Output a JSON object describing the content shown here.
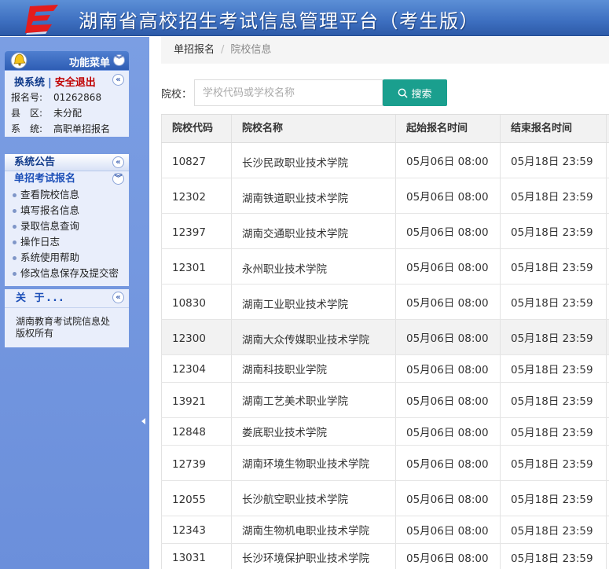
{
  "header": {
    "title": "湖南省高校招生考试信息管理平台（考生版）"
  },
  "sidebar": {
    "menu_title": "功能菜单",
    "user": {
      "switch_label": "换系统",
      "separator": "|",
      "logout_label": "安全退出",
      "fields": [
        {
          "label": "报名号:",
          "value": "01262868"
        },
        {
          "label": "县　区:",
          "value": "未分配"
        },
        {
          "label": "系　统:",
          "value": "高职单招报名"
        }
      ]
    },
    "nav": {
      "notice_title": "系统公告",
      "section_title": "单招考试报名",
      "items": [
        {
          "label": "查看院校信息"
        },
        {
          "label": "填写报名信息"
        },
        {
          "label": "录取信息查询"
        },
        {
          "label": "操作日志"
        },
        {
          "label": "系统使用帮助"
        },
        {
          "label": "修改信息保存及提交密"
        }
      ]
    },
    "about": {
      "title": "关 于...",
      "text": "湖南教育考试院信息处版权所有"
    }
  },
  "breadcrumb": {
    "items": [
      "单招报名",
      "院校信息"
    ]
  },
  "search": {
    "label": "院校：",
    "placeholder": "学校代码或学校名称",
    "button_label": "搜索"
  },
  "table": {
    "columns": [
      "院校代码",
      "院校名称",
      "起始报名时间",
      "结束报名时间"
    ],
    "rows": [
      {
        "code": "10827",
        "name": "长沙民政职业技术学院",
        "start": "05月06日 08:00",
        "end": "05月18日 23:59"
      },
      {
        "code": "12302",
        "name": "湖南铁道职业技术学院",
        "start": "05月06日 08:00",
        "end": "05月18日 23:59"
      },
      {
        "code": "12397",
        "name": "湖南交通职业技术学院",
        "start": "05月06日 08:00",
        "end": "05月18日 23:59"
      },
      {
        "code": "12301",
        "name": "永州职业技术学院",
        "start": "05月06日 08:00",
        "end": "05月18日 23:59"
      },
      {
        "code": "10830",
        "name": "湖南工业职业技术学院",
        "start": "05月06日 08:00",
        "end": "05月18日 23:59"
      },
      {
        "code": "12300",
        "name": "湖南大众传媒职业技术学院",
        "start": "05月06日 08:00",
        "end": "05月18日 23:59"
      },
      {
        "code": "12304",
        "name": "湖南科技职业学院",
        "start": "05月06日 08:00",
        "end": "05月18日 23:59"
      },
      {
        "code": "13921",
        "name": "湖南工艺美术职业学院",
        "start": "05月06日 08:00",
        "end": "05月18日 23:59"
      },
      {
        "code": "12848",
        "name": "娄底职业技术学院",
        "start": "05月06日 08:00",
        "end": "05月18日 23:59"
      },
      {
        "code": "12739",
        "name": "湖南环境生物职业技术学院",
        "start": "05月06日 08:00",
        "end": "05月18日 23:59"
      },
      {
        "code": "12055",
        "name": "长沙航空职业技术学院",
        "start": "05月06日 08:00",
        "end": "05月18日 23:59"
      },
      {
        "code": "12343",
        "name": "湖南生物机电职业技术学院",
        "start": "05月06日 08:00",
        "end": "05月18日 23:59"
      },
      {
        "code": "13031",
        "name": "长沙环境保护职业技术学院",
        "start": "05月06日 08:00",
        "end": "05月18日 23:59"
      }
    ]
  }
}
